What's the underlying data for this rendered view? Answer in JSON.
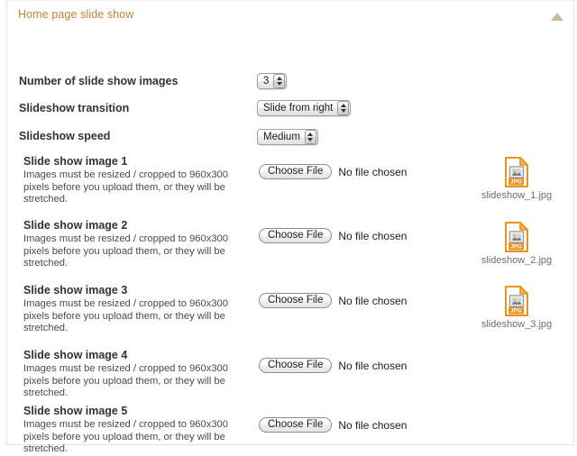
{
  "panel": {
    "title": "Home page slide show",
    "collapse_icon": "triangle-up-icon",
    "collapse_color": "#cbbba6",
    "title_color": "#c4803a"
  },
  "settings": [
    {
      "label": "Number of slide show images",
      "value": "3",
      "control": "popup-select"
    },
    {
      "label": "Slideshow transition",
      "value": "Slide from right",
      "control": "popup-select"
    },
    {
      "label": "Slideshow speed",
      "value": "Medium",
      "control": "popup-select"
    }
  ],
  "image_rows": [
    {
      "title": "Slide show image 1",
      "description": "Images must be resized / cropped to 960x300 pixels before you upload them, or they will be stretched.",
      "choose_label": "Choose File",
      "file_status": "No file chosen",
      "thumb_icon": "jpg-file-icon",
      "thumb_name": "slideshow_1.jpg",
      "has_thumb": true
    },
    {
      "title": "Slide show image 2",
      "description": "Images must be resized / cropped to 960x300 pixels before you upload them, or they will be stretched.",
      "choose_label": "Choose File",
      "file_status": "No file chosen",
      "thumb_icon": "jpg-file-icon",
      "thumb_name": "slideshow_2.jpg",
      "has_thumb": true
    },
    {
      "title": "Slide show image 3",
      "description": "Images must be resized / cropped to 960x300 pixels before you upload them, or they will be stretched.",
      "choose_label": "Choose File",
      "file_status": "No file chosen",
      "thumb_icon": "jpg-file-icon",
      "thumb_name": "slideshow_3.jpg",
      "has_thumb": true
    },
    {
      "title": "Slide show image 4",
      "description": "Images must be resized / cropped to 960x300 pixels before you upload them, or they will be stretched.",
      "choose_label": "Choose File",
      "file_status": "No file chosen",
      "thumb_icon": null,
      "thumb_name": "",
      "has_thumb": false
    },
    {
      "title": "Slide show image 5",
      "description": "Images must be resized / cropped to 960x300 pixels before you upload them, or they will be stretched.",
      "choose_label": "Choose File",
      "file_status": "No file chosen",
      "thumb_icon": null,
      "thumb_name": "",
      "has_thumb": false
    }
  ],
  "colors": {
    "accent": "#c4803a",
    "panel_border": "#e2e2e2",
    "label_text": "#333333",
    "body_text": "#4a4a4a",
    "thumb_text": "#6e6e6e",
    "icon_orange": "#e8921f",
    "icon_tan": "#f2b659"
  }
}
